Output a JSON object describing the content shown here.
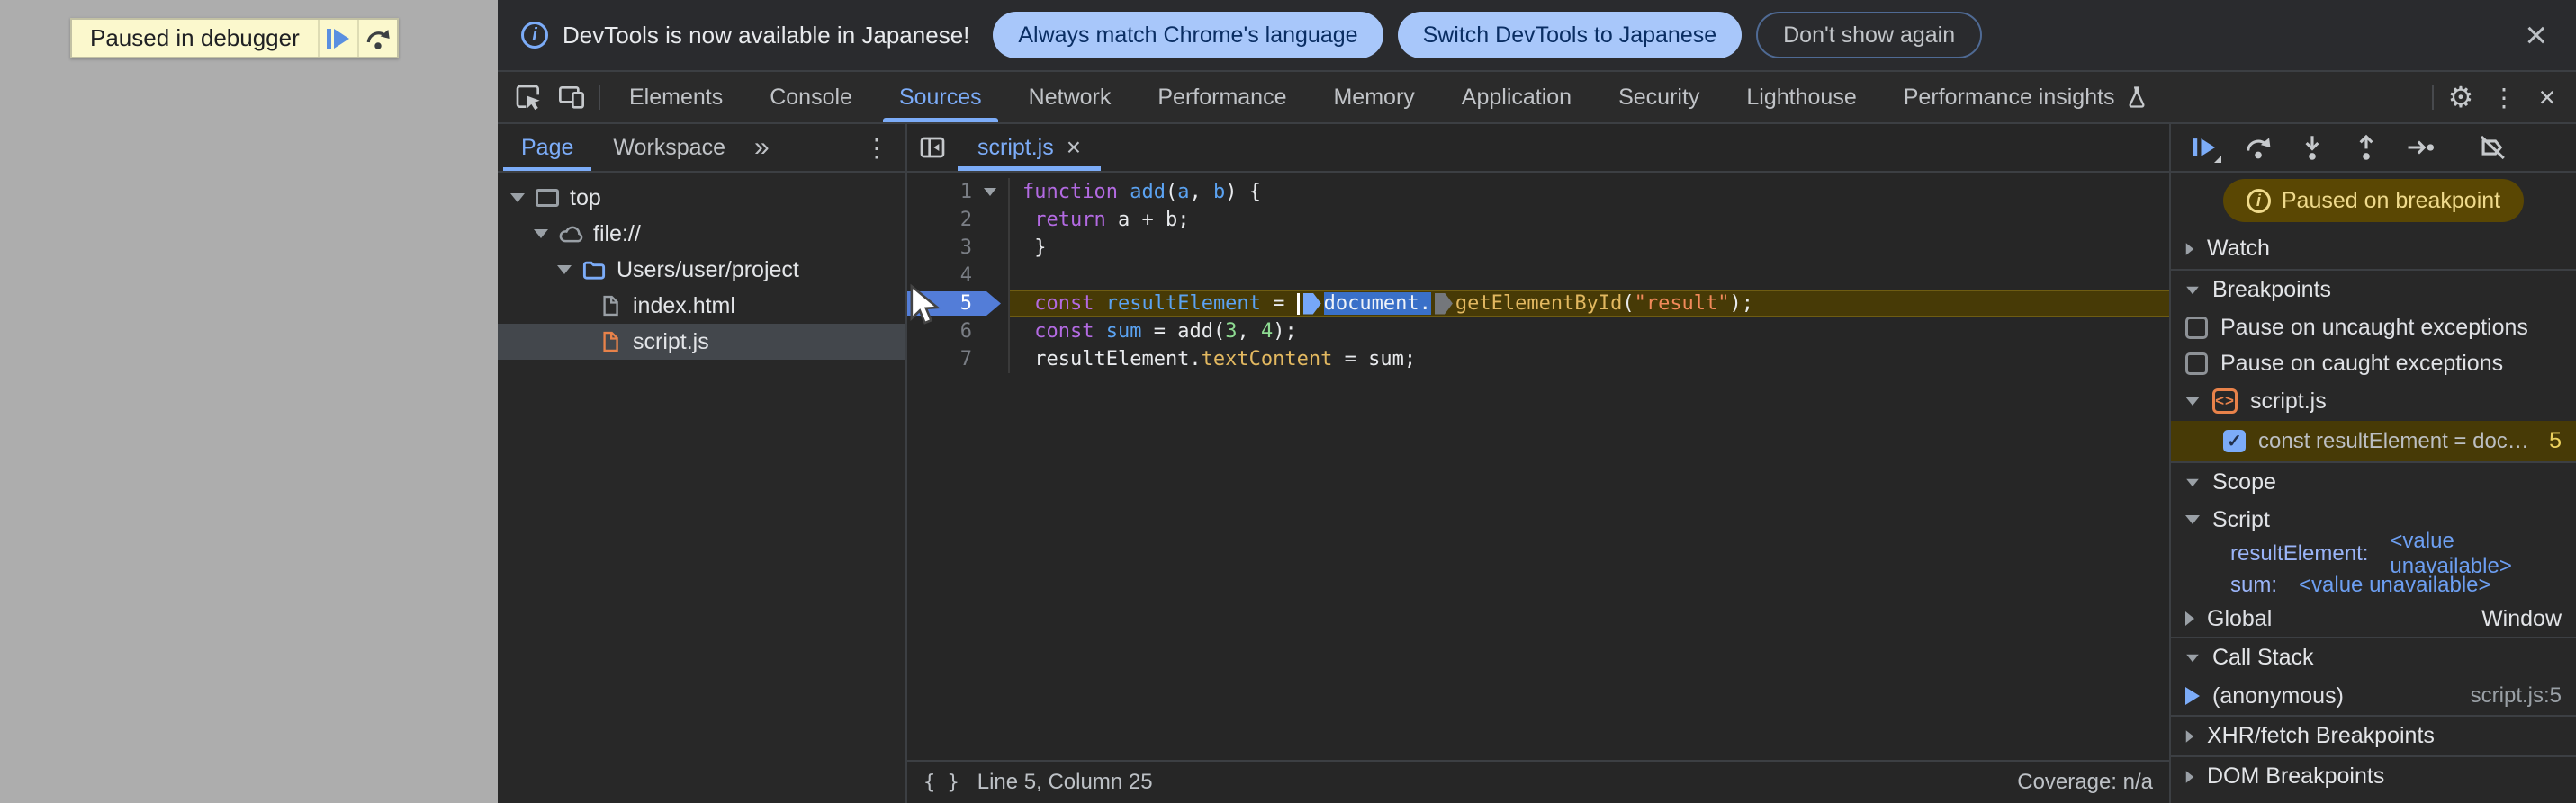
{
  "theme": {
    "accent_blue": "#7cacf8",
    "paused_yellow": "#efda8c",
    "breakpoint_blue": "#537dd8",
    "selection_blue": "#3a70c8",
    "string_orange": "#f28a5a"
  },
  "icons": {
    "more_tabs": "»",
    "kebab": "⋮",
    "close": "×",
    "gear": "⚙",
    "pretty_print": "{ }",
    "check": "✓",
    "info": "i",
    "code_tag": "<>"
  },
  "page": {
    "paused_banner": {
      "text": "Paused in debugger"
    }
  },
  "infobar": {
    "message": "DevTools is now available in Japanese!",
    "actions": {
      "match": "Always match Chrome's language",
      "switch": "Switch DevTools to Japanese",
      "dismiss": "Don't show again"
    }
  },
  "toolbar": {
    "tabs": [
      "Elements",
      "Console",
      "Sources",
      "Network",
      "Performance",
      "Memory",
      "Application",
      "Security",
      "Lighthouse",
      "Performance insights"
    ],
    "selected": "Sources"
  },
  "navigator": {
    "tabs": {
      "page": "Page",
      "workspace": "Workspace"
    },
    "tree": [
      {
        "label": "top"
      },
      {
        "label": "file://"
      },
      {
        "label": "Users/user/project"
      },
      {
        "label": "index.html"
      },
      {
        "label": "script.js"
      }
    ]
  },
  "editor": {
    "tab": "script.js",
    "lines": [
      {
        "num": "1",
        "tokens": [
          {
            "t": "function"
          },
          {
            "t": " "
          },
          {
            "t": "add"
          },
          {
            "t": "("
          },
          {
            "t": "a"
          },
          {
            "t": ", "
          },
          {
            "t": "b"
          },
          {
            "t": ") {"
          }
        ]
      },
      {
        "num": "2",
        "tokens": [
          {
            "t": " "
          },
          {
            "t": "return"
          },
          {
            "t": " a + b;"
          }
        ]
      },
      {
        "num": "3",
        "tokens": [
          {
            "t": " }"
          }
        ]
      },
      {
        "num": "4",
        "tokens": []
      },
      {
        "num": "5",
        "tokens": [
          {
            "t": " "
          },
          {
            "t": "const"
          },
          {
            "t": " "
          },
          {
            "t": "resultElement"
          },
          {
            "t": " = "
          },
          {
            "t": "document."
          },
          {
            "t": "getElementById"
          },
          {
            "t": "("
          },
          {
            "t": "\"result\""
          },
          {
            "t": ");"
          }
        ]
      },
      {
        "num": "6",
        "tokens": [
          {
            "t": " "
          },
          {
            "t": "const"
          },
          {
            "t": " "
          },
          {
            "t": "sum"
          },
          {
            "t": " = add("
          },
          {
            "t": "3"
          },
          {
            "t": ", "
          },
          {
            "t": "4"
          },
          {
            "t": ");"
          }
        ]
      },
      {
        "num": "7",
        "tokens": [
          {
            "t": " resultElement."
          },
          {
            "t": "textContent"
          },
          {
            "t": " = sum;"
          }
        ]
      }
    ],
    "status": {
      "position": "Line 5, Column 25",
      "coverage": "Coverage: n/a"
    }
  },
  "debugger": {
    "paused_badge": "Paused on breakpoint",
    "sections": {
      "watch": "Watch",
      "breakpoints": "Breakpoints",
      "scope": "Scope",
      "call_stack": "Call Stack",
      "xhr": "XHR/fetch Breakpoints",
      "dom": "DOM Breakpoints"
    },
    "breakpoints": {
      "pause_uncaught": "Pause on uncaught exceptions",
      "pause_caught": "Pause on caught exceptions",
      "file": "script.js",
      "entry": {
        "code": "const resultElement = doc…",
        "line": "5"
      }
    },
    "scope": {
      "script_label": "Script",
      "vars": [
        {
          "name": "resultElement:",
          "value": "<value unavailable>"
        },
        {
          "name": "sum:",
          "value": "<value unavailable>"
        }
      ],
      "global_label": "Global",
      "global_value": "Window"
    },
    "call_stack": {
      "frame": "(anonymous)",
      "location": "script.js:5"
    }
  }
}
